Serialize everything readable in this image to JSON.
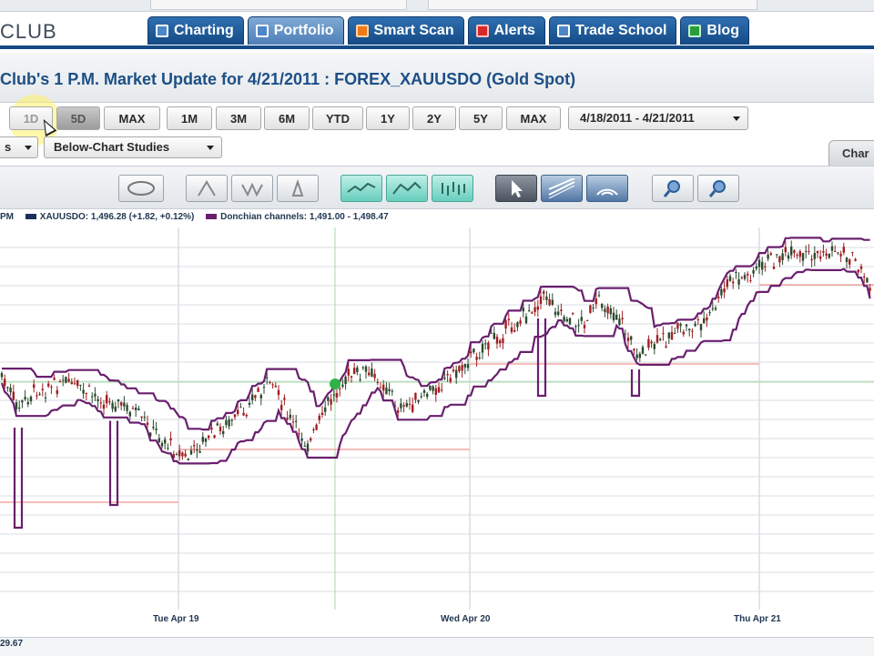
{
  "brand": "CLUB",
  "nav_tabs": [
    {
      "label": "Charting",
      "active": false,
      "icon": "chart-icon"
    },
    {
      "label": "Portfolio",
      "active": true,
      "icon": "portfolio-icon"
    },
    {
      "label": "Smart Scan",
      "active": false,
      "icon": "scan-icon"
    },
    {
      "label": "Alerts",
      "active": false,
      "icon": "alert-icon"
    },
    {
      "label": "Trade School",
      "active": false,
      "icon": "school-icon"
    },
    {
      "label": "Blog",
      "active": false,
      "icon": "blog-icon"
    }
  ],
  "page_title": "Club's 1 P.M. Market Update for 4/21/2011 : FOREX_XAUUSDO (Gold Spot)",
  "range_buttons": [
    "1D",
    "5D",
    "MAX",
    "1M",
    "3M",
    "6M",
    "YTD",
    "1Y",
    "2Y",
    "5Y",
    "MAX"
  ],
  "date_range": "4/18/2011 - 4/21/2011",
  "studies_left": "s",
  "below_chart_studies": "Below-Chart Studies",
  "right_tab_label": "Char",
  "legend": {
    "time_fragment": "PM",
    "series_label": "XAUUSDO: 1,496.28 (+1.82, +0.12%)",
    "donchian_label": "Donchian channels: 1,491.00 - 1,498.47",
    "series_color": "#1a2f5a",
    "donchian_color": "#6a1f6e"
  },
  "chart_data": {
    "type": "candlestick",
    "xlabels": [
      "Tue Apr 19",
      "Wed Apr 20",
      "Thu Apr 21"
    ],
    "ylabel_bottom": "29.67",
    "colors": {
      "up": "#2b4a2f",
      "down": "#a01f22",
      "channel": "#6a1f6e",
      "ref_line": "#f2a7a2",
      "grid": "#d9dde3"
    }
  }
}
